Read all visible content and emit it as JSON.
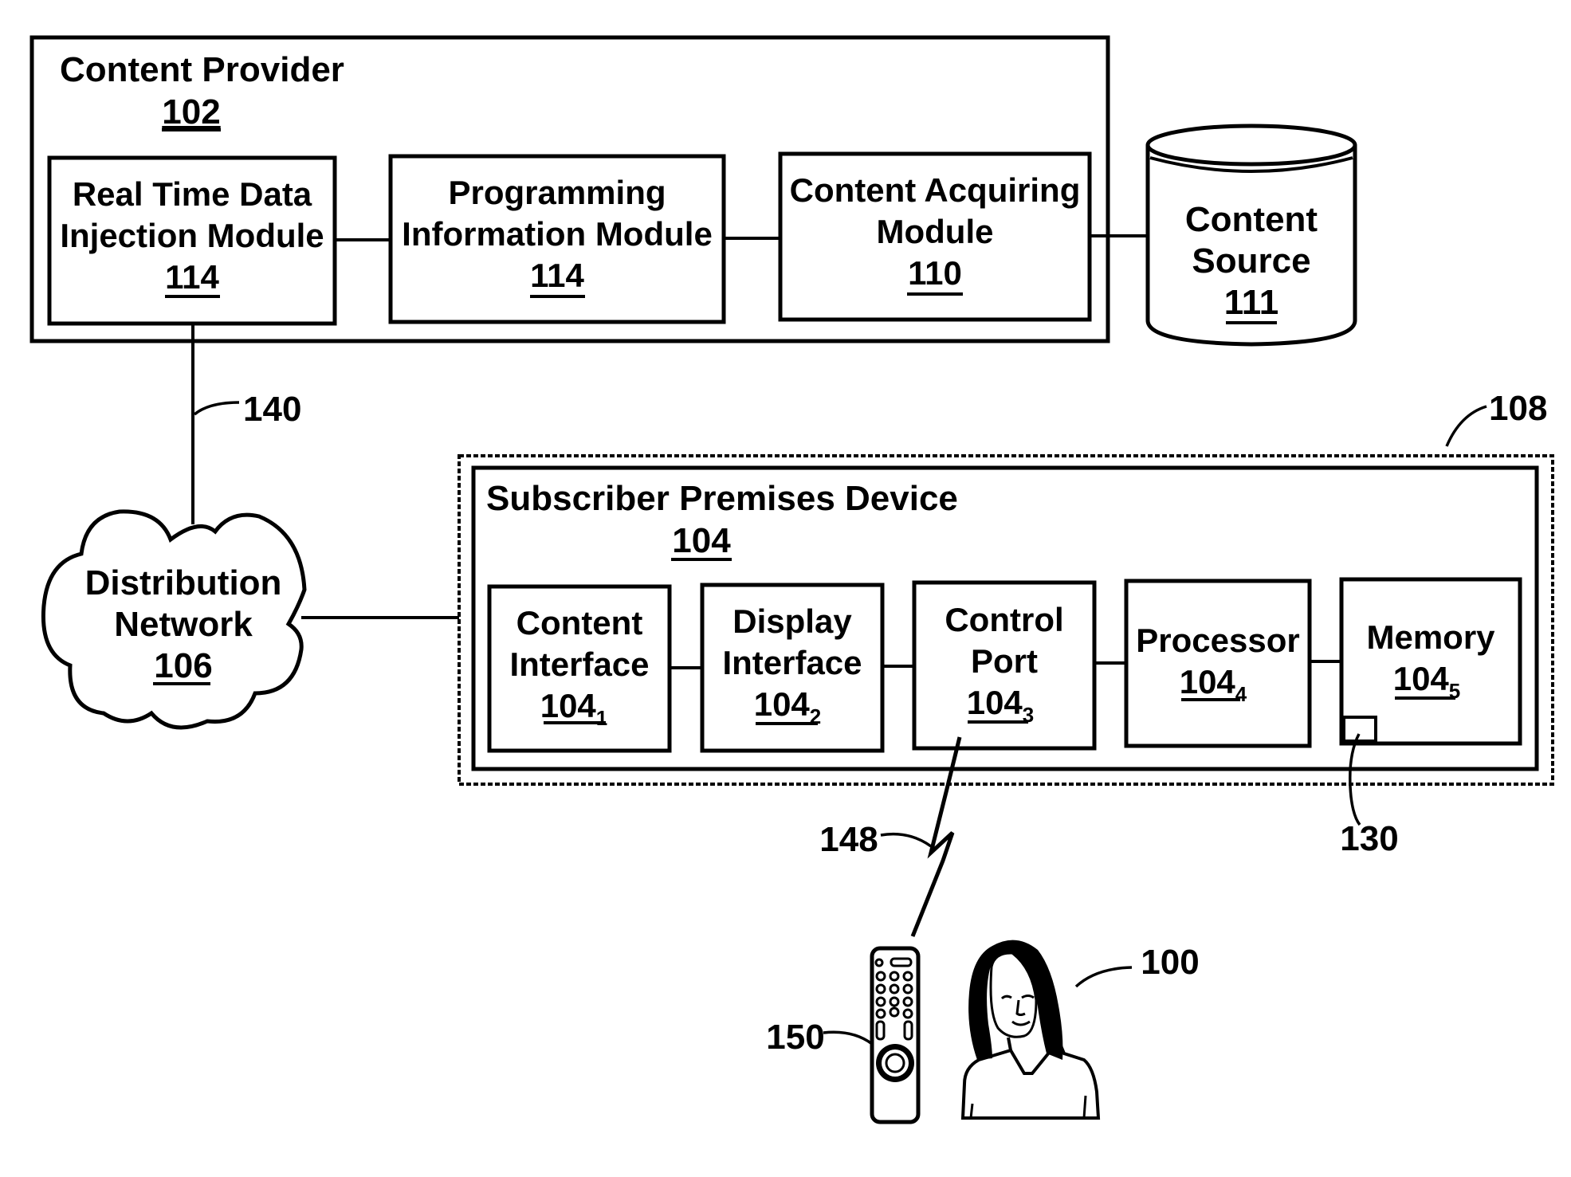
{
  "figure": {
    "content_provider": {
      "title": "Content Provider",
      "ref": "102"
    },
    "modules": [
      {
        "line1": "Real Time Data",
        "line2": "Injection Module",
        "ref": "114"
      },
      {
        "line1": "Programming",
        "line2": "Information Module",
        "ref": "114"
      },
      {
        "line1": "Content Acquiring",
        "line2": "Module",
        "ref": "110"
      }
    ],
    "content_source": {
      "line1": "Content",
      "line2": "Source",
      "ref": "111"
    },
    "distribution_network": {
      "line1": "Distribution",
      "line2": "Network",
      "ref": "106"
    },
    "link_140": "140",
    "group_108": "108",
    "subscriber_device": {
      "title": "Subscriber Premises Device",
      "ref": "104"
    },
    "components": [
      {
        "line1": "Content",
        "line2": "Interface",
        "ref": "104",
        "sub": "1"
      },
      {
        "line1": "Display",
        "line2": "Interface",
        "ref": "104",
        "sub": "2"
      },
      {
        "line1": "Control",
        "line2": "Port",
        "ref": "104",
        "sub": "3"
      },
      {
        "line1": "Processor",
        "line2": "",
        "ref": "104",
        "sub": "4"
      },
      {
        "line1": "Memory",
        "line2": "",
        "ref": "104",
        "sub": "5"
      }
    ],
    "memory_block_ref": "130",
    "wireless_link_ref": "148",
    "remote_ref": "150",
    "user_ref": "100"
  }
}
